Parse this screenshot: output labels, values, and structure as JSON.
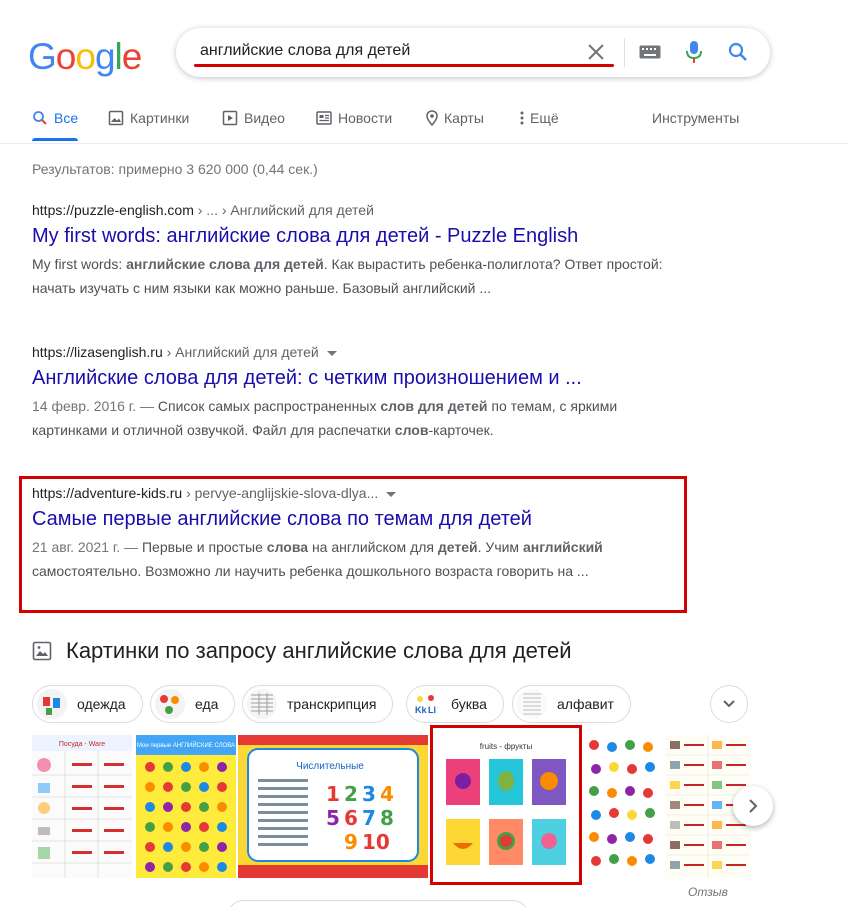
{
  "logo": {
    "text": "Google"
  },
  "search": {
    "query": "английские слова для детей"
  },
  "tabs": [
    {
      "label": "Все",
      "icon": "search-icon"
    },
    {
      "label": "Картинки",
      "icon": "image-icon"
    },
    {
      "label": "Видео",
      "icon": "video-icon"
    },
    {
      "label": "Новости",
      "icon": "news-icon"
    },
    {
      "label": "Карты",
      "icon": "map-pin-icon"
    },
    {
      "label": "Ещё",
      "icon": "more-vert-icon"
    }
  ],
  "tools_label": "Инструменты",
  "stats": "Результатов: примерно 3 620 000 (0,44 сек.)",
  "results": [
    {
      "domain": "https://puzzle-english.com",
      "crumb": " › ... › Английский для детей",
      "title": "My first words: английские слова для детей - Puzzle English",
      "date": "",
      "snippet_html": "My first words: <b>английские слова для детей</b>. Как вырастить ребенка-полиглота? Ответ простой: начать изучать с ним языки как можно раньше. Базовый английский ..."
    },
    {
      "domain": "https://lizasenglish.ru",
      "crumb": " › Английский для детей",
      "title": "Английские слова для детей: с четким произношением и ...",
      "date": "14 февр. 2016 г. — ",
      "snippet_html": "Список самых распространенных <b>слов для детей</b> по темам, с яркими картинками и отличной озвучкой. Файл для распечатки <b>слов</b>-карточек."
    },
    {
      "domain": "https://adventure-kids.ru",
      "crumb": " › pervye-anglijskie-slova-dlya...",
      "title": "Самые первые английские слова по темам для детей",
      "date": "21 авг. 2021 г. — ",
      "snippet_html": "Первые и простые <b>слова</b> на английском для <b>детей</b>. Учим <b>английский</b> самостоятельно. Возможно ли научить ребенка дошкольного возраста говорить на ..."
    }
  ],
  "images_section": {
    "title": "Картинки по запросу английские слова для детей"
  },
  "chips": [
    "одежда",
    "еда",
    "транскрипция",
    "буква",
    "алфавит"
  ],
  "image_texts": {
    "posuda": "Посуда - Ware",
    "moi_slova": "Мои первые АНГЛИЙСКИЕ СЛОВА",
    "chislitelnye": "Числительные",
    "fruits": "fruits - фрукты"
  },
  "feedback": "Отзыв",
  "colors": {
    "link": "#1a0dab",
    "accent": "#1a73e8",
    "highlight": "#d50000"
  }
}
